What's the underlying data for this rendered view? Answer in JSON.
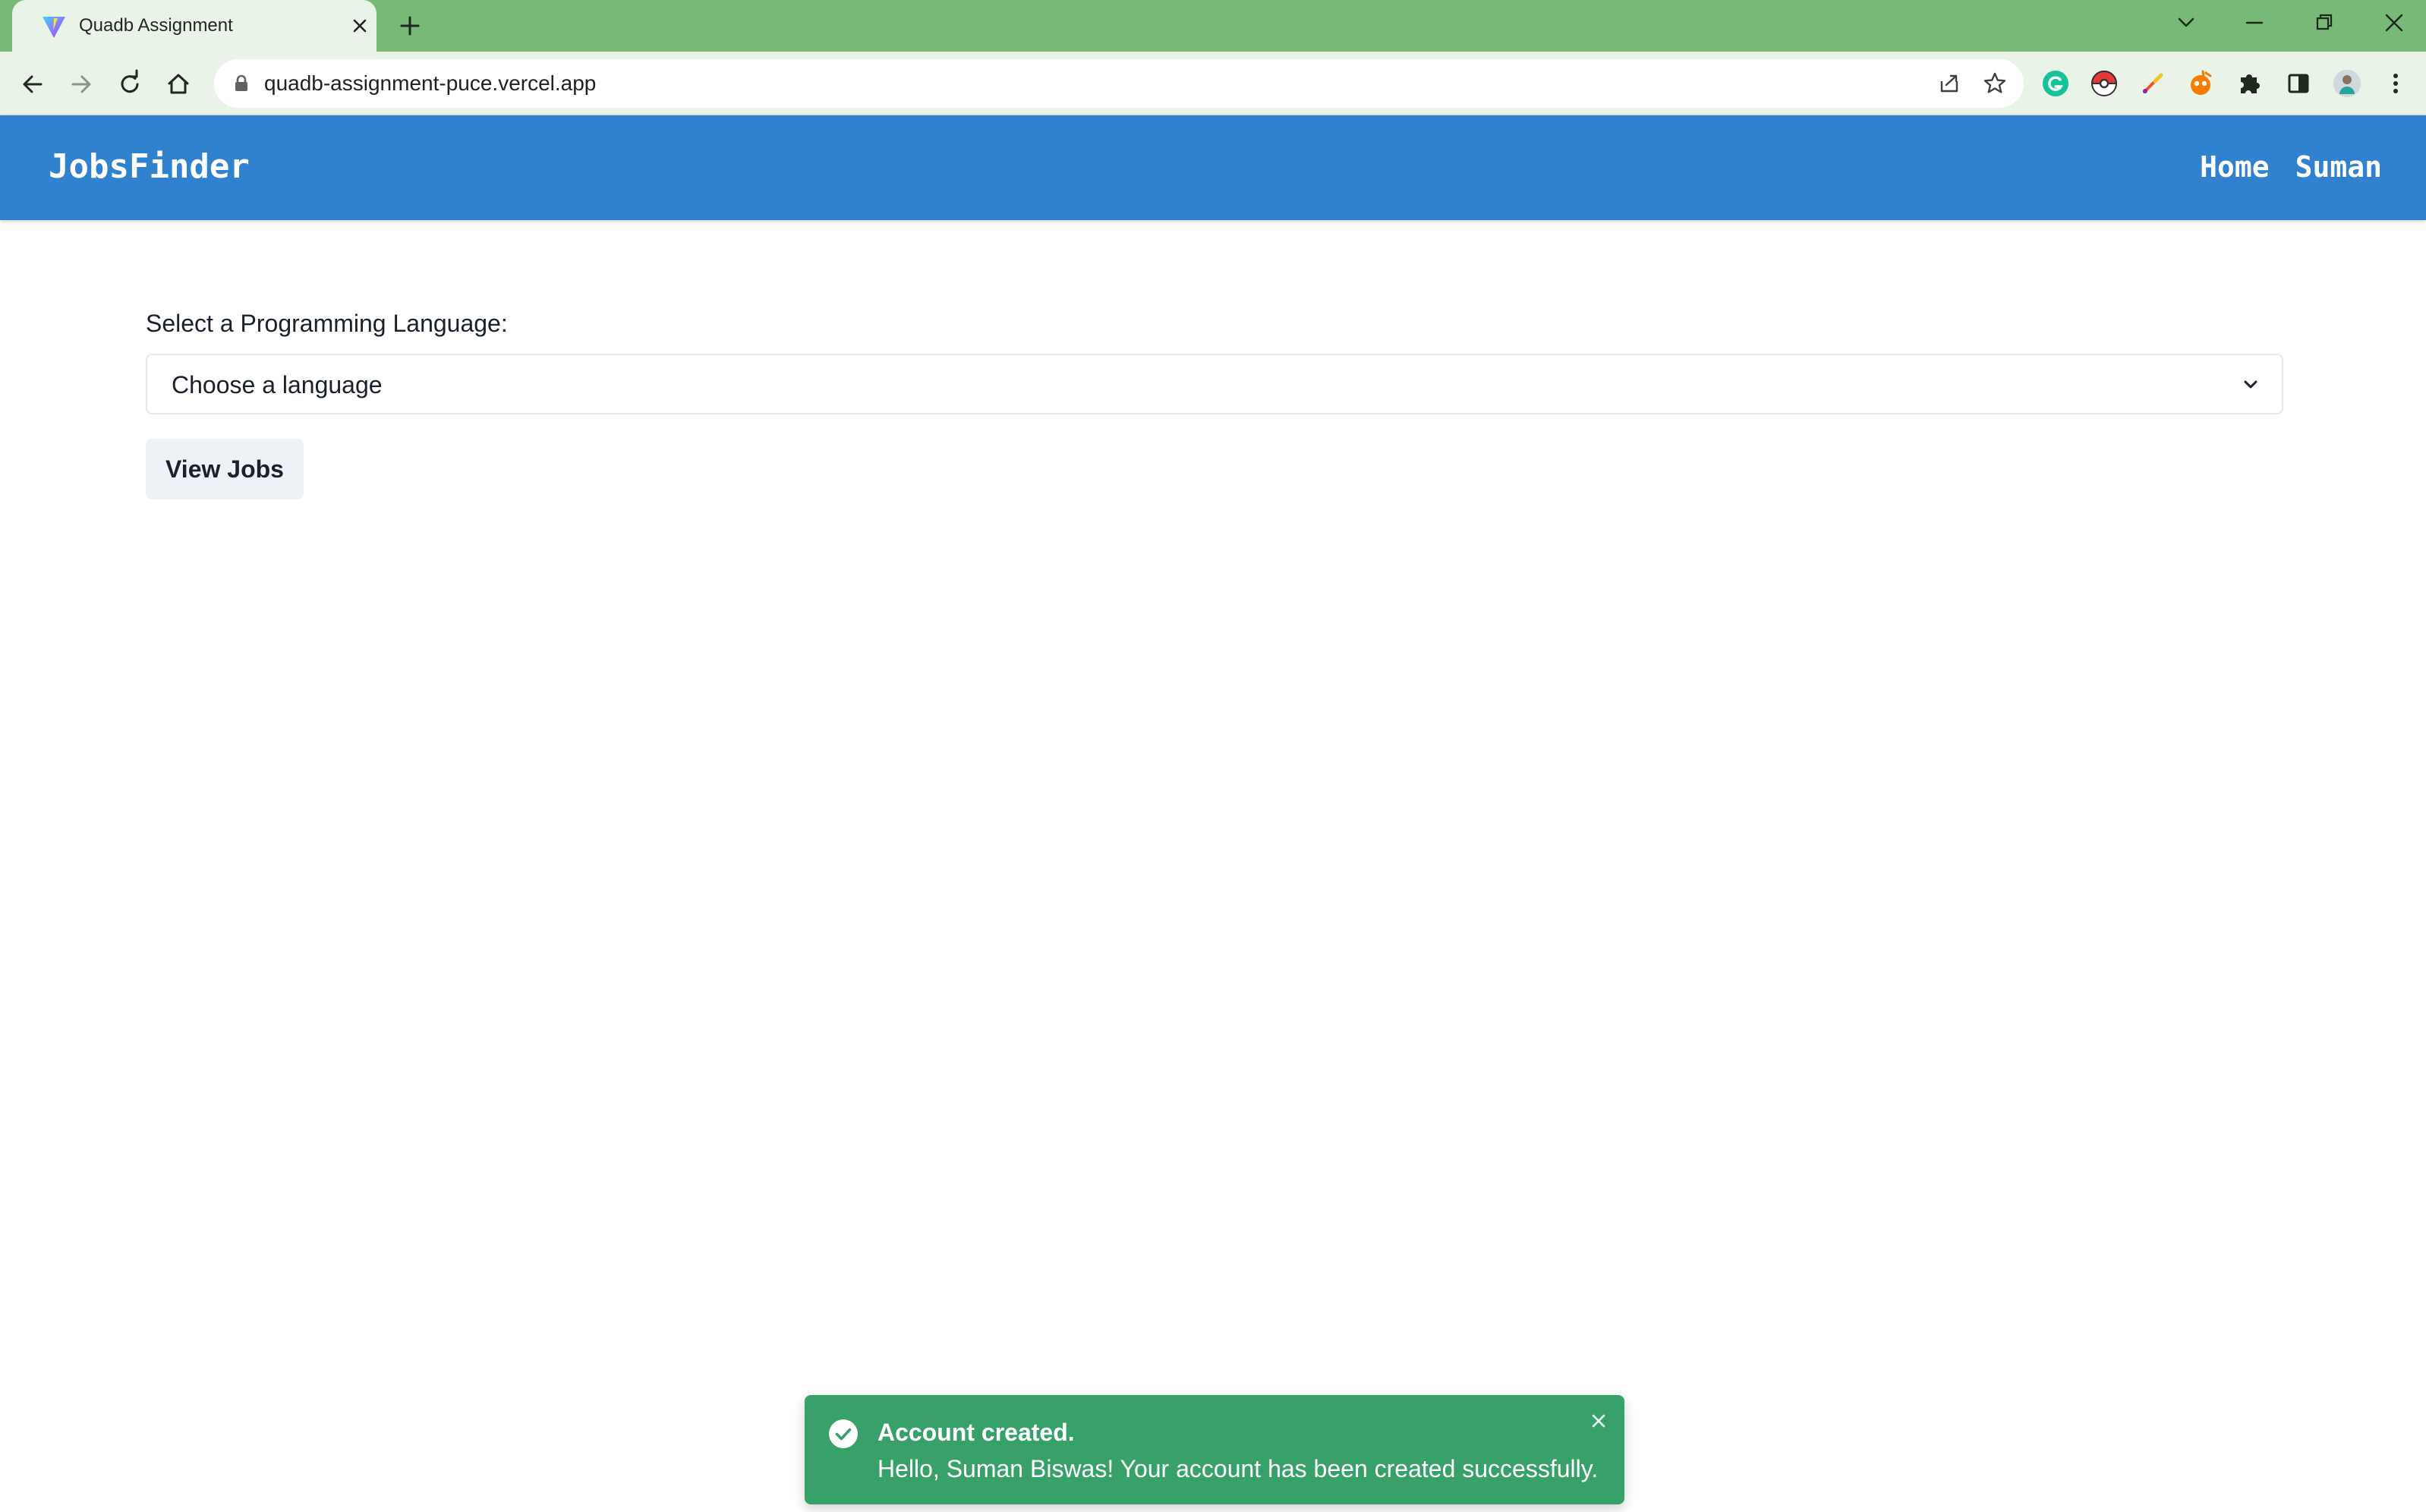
{
  "browser": {
    "tab": {
      "title": "Quadb Assignment"
    },
    "address_bar": {
      "url": "quadb-assignment-puce.vercel.app"
    }
  },
  "app": {
    "brand": "JobsFinder",
    "nav": [
      {
        "label": "Home"
      },
      {
        "label": "Suman"
      }
    ],
    "form": {
      "label": "Select a Programming Language:",
      "select": {
        "selected": "Choose a language"
      },
      "submit_label": "View Jobs"
    },
    "toast": {
      "title": "Account created.",
      "description": "Hello, Suman Biswas! Your account has been created successfully."
    }
  },
  "colors": {
    "chrome_frame": "#78b977",
    "toolbar": "#e9f3e7",
    "navbar": "#3182ce",
    "toast": "#38a169",
    "button_bg": "#edf2f7",
    "text": "#1a202c"
  },
  "icons": {
    "tab_favicon": "vite-logo-icon",
    "tab_close": "close-icon",
    "new_tab": "plus-icon",
    "back": "arrow-left-icon",
    "forward": "arrow-right-icon",
    "reload": "reload-icon",
    "home": "home-icon",
    "lock": "lock-icon",
    "share": "share-icon",
    "bookmark": "star-icon",
    "extensions": "puzzle-icon",
    "side_panel": "side-panel-icon",
    "menu": "kebab-menu-icon",
    "select_chevron": "chevron-down-icon",
    "toast_status": "check-circle-icon",
    "toast_close": "close-icon"
  }
}
